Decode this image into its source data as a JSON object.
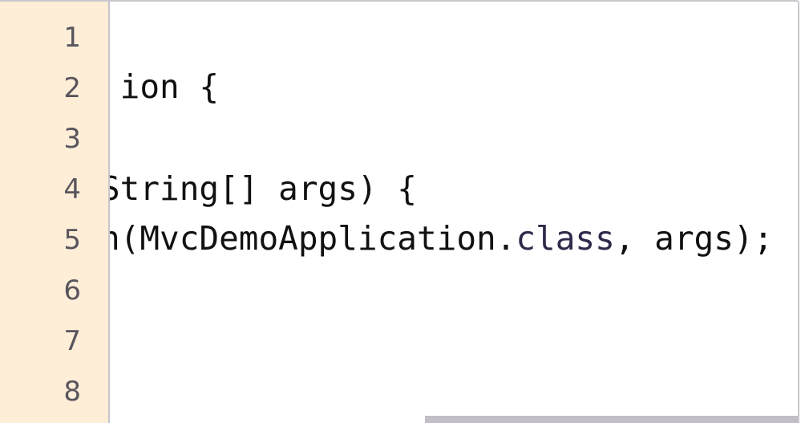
{
  "gutter": {
    "line_numbers": [
      "1",
      "2",
      "3",
      "4",
      "5",
      "6",
      "7",
      "8"
    ]
  },
  "code": {
    "line2": " ion {",
    "line4": "String[] args) {",
    "line5_a": "n(MvcDemoApplication.",
    "line5_kw": "class",
    "line5_b": ", args);"
  },
  "colors": {
    "gutter_bg": "#feeed8",
    "keyword": "#2e2a4a",
    "scrollbar": "#c2bdc6"
  }
}
